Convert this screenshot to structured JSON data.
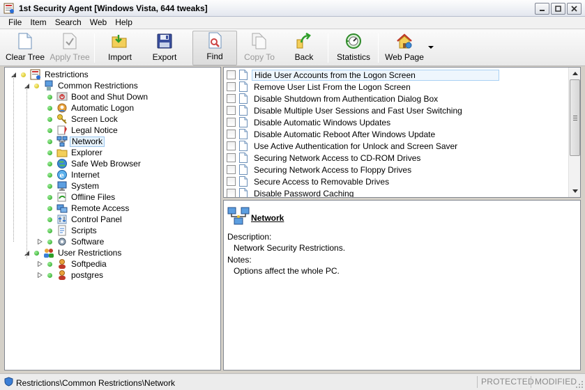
{
  "window": {
    "title": "1st Security Agent [Windows Vista, 644 tweaks]"
  },
  "menu": [
    "File",
    "Item",
    "Search",
    "Web",
    "Help"
  ],
  "toolbar": {
    "clear_tree": "Clear Tree",
    "apply_tree": "Apply Tree",
    "import": "Import",
    "export": "Export",
    "find": "Find",
    "copy_to": "Copy To",
    "back": "Back",
    "statistics": "Statistics",
    "web_page": "Web Page"
  },
  "tree": {
    "root": "Restrictions",
    "common": "Common Restrictions",
    "common_children": [
      "Boot and Shut Down",
      "Automatic Logon",
      "Screen Lock",
      "Legal Notice",
      "Network",
      "Explorer",
      "Safe Web Browser",
      "Internet",
      "System",
      "Offline Files",
      "Remote Access",
      "Control Panel",
      "Scripts",
      "Software"
    ],
    "user": "User Restrictions",
    "user_children": [
      "Softpedia",
      "postgres"
    ],
    "selected": "Network"
  },
  "list": {
    "items": [
      "Hide User Accounts from the Logon Screen",
      "Remove User List From the Logon Screen",
      "Disable Shutdown from Authentication Dialog Box",
      "Disable Multiple User Sessions and Fast User Switching",
      "Disable Automatic Windows Updates",
      "Disable Automatic Reboot After Windows Update",
      "Use Active Authentication for Unlock and Screen Saver",
      "Securing Network Access to CD-ROM Drives",
      "Securing Network Access to Floppy Drives",
      "Secure Access to Removable Drives",
      "Disable Password Caching"
    ]
  },
  "description": {
    "title": "Network",
    "description_label": "Description:",
    "description_text": "Network Security Restrictions.",
    "notes_label": "Notes:",
    "notes_text": "Options affect the whole PC."
  },
  "status": {
    "path": "Restrictions\\Common Restrictions\\Network",
    "protected": "PROTECTED",
    "modified": "MODIFIED"
  }
}
